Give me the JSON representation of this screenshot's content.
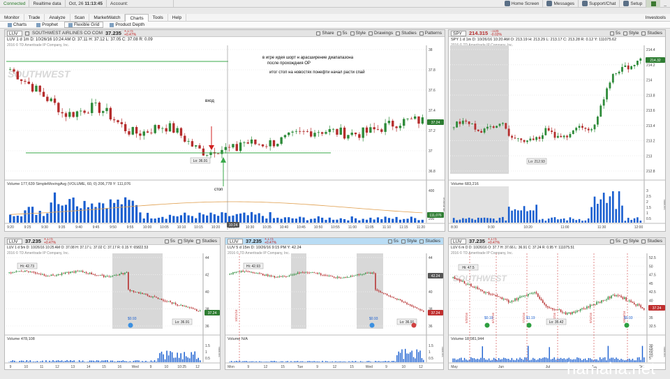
{
  "status_bar": {
    "connection": "Connected",
    "realtime": "Realtime data",
    "date": "Oct, 26",
    "time": "11:13:45",
    "account_label": "Account:",
    "home_screen": "Home Screen",
    "messages": "Messages",
    "support": "Support/Chat",
    "setup": "Setup"
  },
  "menu": {
    "tabs": [
      "Monitor",
      "Trade",
      "Analyze",
      "Scan",
      "MarketWatch",
      "Charts",
      "Tools",
      "Help"
    ],
    "active": "Charts",
    "right_label": "Investools"
  },
  "subtabs": [
    "Charts",
    "Prophet",
    "Flexible Grid",
    "Product Depth"
  ],
  "colors": {
    "up": "#2e8b3a",
    "down": "#b52d2d",
    "volume": "#1a5fd0",
    "sma": "#e0a050",
    "level_line": "#3aa84a"
  },
  "main": {
    "symbol": "LUV",
    "name": "SOUTHWEST AIRLINES CO COM",
    "price": "37.235",
    "change": "+.175",
    "change_pct": "+0.47%",
    "tools": [
      "Share",
      "5s",
      "Style",
      "Drawings",
      "Studies",
      "Patterns"
    ],
    "info": "LUV 1 d 1m   D: 10/26/16 10:24 AM   O: 37.11   H: 37.12   L: 37.05   C: 37.08   R: 0.09",
    "copyright": "2016 © TD Ameritrade IP Company, Inc.",
    "watermark": "SOUTHWEST",
    "low_label": "Lo: 36.91",
    "price_label": "37.24",
    "volume_info": "Volume   177,639   SimpleMovingAvg (VOLUME, 60, 0)   206,778   Y: 111,076",
    "volume_label": "111,076",
    "volume_axis": "thousands",
    "y_ticks": [
      "38",
      "37.8",
      "37.6",
      "37.4",
      "37.2",
      "37",
      "36.8"
    ],
    "vol_ticks": [
      "400",
      "200"
    ],
    "x_ticks": [
      "9:20",
      "9:25",
      "9:30",
      "9:35",
      "9:40",
      "9:45",
      "9:50",
      "9:55",
      "10:00",
      "10:05",
      "10:10",
      "10:15",
      "10:20",
      "10:24",
      "10:30",
      "10:35",
      "10:40",
      "10:45",
      "10:50",
      "10:55",
      "11:00",
      "11:05",
      "11:10",
      "11:15",
      "11:20"
    ],
    "annotations": {
      "note1": "в игре идея шорт н арасширение диапапазона",
      "note2": "после прохождния ОР",
      "note3": "итог стоп на новостях понефти начал расти спай",
      "entry": "вход",
      "stop": "стоп"
    }
  },
  "spy": {
    "symbol": "SPY",
    "price": "214.315",
    "change": "-.035",
    "change_pct": "-0.02%",
    "tools": [
      "5s",
      "Style",
      "Studies"
    ],
    "info": "SPY 1 d 1m   D: 10/26/16 10:20 AM   O: 213.19   H: 213.29   L: 213.17   C: 213.28   R: 0.12   Y: 111075.62",
    "copyright": "2016 © TD Ameritrade IP Company, Inc.",
    "watermark": "SPDRs",
    "low_label": "Lo: 212.93",
    "price_label": "214.32",
    "volume_info": "Volume   683,216",
    "volume_axis": "millions",
    "y_ticks": [
      "214.4",
      "214.2",
      "214",
      "213.8",
      "213.6",
      "213.4",
      "213.2",
      "213",
      "212.8"
    ],
    "vol_ticks": [
      "3",
      "2.5",
      "2",
      "1.5",
      "1",
      "0.5"
    ],
    "x_ticks": [
      "8:30",
      "9:30",
      "10:20",
      "11:00",
      "11:30",
      "12:00"
    ]
  },
  "bottom": [
    {
      "symbol": "LUV",
      "price": "37.235",
      "change": "+.175",
      "change_pct": "+0.47%",
      "tools": [
        "5s",
        "Style",
        "Studies"
      ],
      "info": "LUV 1 d 5m   D: 10/26/16 10:25 AM   O: 37.08   H: 37.17   L: 37.02   C: 37.17   R: 0.15   Y: 65822.53",
      "copyright": "2016 © TD Ameritrade IP Company, Inc.",
      "hi_label": "Hi: 42.73",
      "low_label": "Lo: 36.91",
      "price_label": "37.24",
      "event_label": "$0.93",
      "volume_info": "Volume   478,108",
      "volume_axis": "millions",
      "y_ticks": [
        "44",
        "42",
        "40",
        "38",
        "36"
      ],
      "vol_ticks": [
        "1.5",
        "1",
        "0.5"
      ],
      "x_ticks": [
        "9",
        "10",
        "11",
        "12",
        "13",
        "14",
        "15",
        "16",
        "Wed",
        "9",
        "10",
        "10:25",
        "12"
      ]
    },
    {
      "symbol": "LUV",
      "price": "37.235",
      "change": "+.175",
      "change_pct": "+0.47%",
      "tools": [
        "5s",
        "Style",
        "Studies"
      ],
      "info": "LUV 5 d 15m   D: 10/26/16 9:15 PM   Y: 42.24",
      "copyright": "2016 © TD Ameritrade IP Company, Inc.",
      "hi_label": "Hi: 42.93",
      "low_label": "Lo: 36.91",
      "price_label": "37.24",
      "side_label": "42.24",
      "event_label": "$0.93",
      "volume_info": "Volume   N/A",
      "volume_axis": "millions",
      "y_ticks": [
        "44",
        "42",
        "40",
        "38",
        "36"
      ],
      "vol_ticks": [
        "1.5",
        "1",
        "0.5"
      ],
      "x_ticks": [
        "Mon",
        "9",
        "12",
        "15",
        "Tue",
        "9",
        "12",
        "15",
        "Wed",
        "9",
        "10",
        "12"
      ],
      "date_mark": "10/21/16"
    },
    {
      "symbol": "LUV",
      "price": "37.235",
      "change": "+.175",
      "change_pct": "+0.47%",
      "tools": [
        "5s",
        "Style",
        "Studies"
      ],
      "info": "LUV 6 m D   D: 10/26/16   O: 37.7   H: 37.66   L: 36.91   C: 37.24   R: 0.95   Y: 111075.51",
      "copyright": "2016 © TD Ameritrade IP Company, Inc.",
      "watermark": "SOUTHWEST",
      "hi_label": "Hi: 47.5",
      "low_label": "Lo: 35.42",
      "price_label": "37.24",
      "event_labels": [
        "$0.10",
        "$1.19",
        "$0.93"
      ],
      "volume_info": "Volume   18,081,944",
      "volume_axis": "millions",
      "y_ticks": [
        "52.5",
        "50",
        "47.5",
        "45",
        "42.5",
        "40",
        "37.5",
        "35",
        "32.5"
      ],
      "vol_ticks": [
        "30",
        "25",
        "20",
        "15",
        "10",
        "5"
      ],
      "x_ticks": [
        "May",
        "Jun",
        "Jul",
        "Aug",
        "Oct"
      ],
      "date_marks": [
        "5/20/16",
        "6/17/16",
        "7/15/16",
        "8/12/16",
        "9/16/16",
        "10/13/16"
      ]
    }
  ],
  "site_watermark": "hamaha.net"
}
